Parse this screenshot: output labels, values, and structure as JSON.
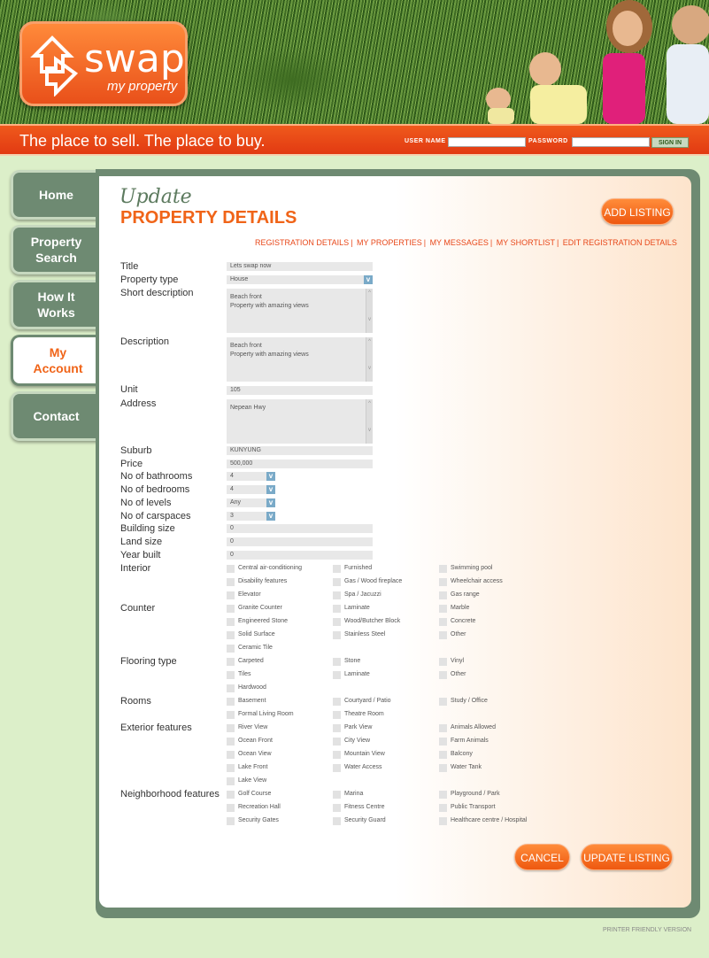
{
  "brand": {
    "name": "swap",
    "sub": "my property"
  },
  "tagline": "The place to sell. The place to buy.",
  "login": {
    "user_label": "USER NAME",
    "pass_label": "PASSWORD",
    "signin": "SIGN IN"
  },
  "nav": [
    {
      "label": "Home"
    },
    {
      "label": "Property Search"
    },
    {
      "label": "How It Works"
    },
    {
      "label": "My Account"
    },
    {
      "label": "Contact"
    }
  ],
  "heading": {
    "script": "Update",
    "main": "PROPERTY DETAILS"
  },
  "add_listing": "ADD LISTING",
  "links": [
    "REGISTRATION DETAILS",
    "MY PROPERTIES",
    "MY MESSAGES",
    "MY SHORTLIST",
    "EDIT REGISTRATION DETAILS"
  ],
  "fields": {
    "title": {
      "label": "Title",
      "value": "Lets swap now"
    },
    "ptype": {
      "label": "Property type",
      "value": "House"
    },
    "short": {
      "label": "Short description",
      "line1": "Beach front",
      "line2": "Property with amazing views"
    },
    "desc": {
      "label": "Description",
      "line1": "Beach front",
      "line2": "Property with amazing views"
    },
    "unit": {
      "label": "Unit",
      "value": "105"
    },
    "address": {
      "label": "Address",
      "value": "Nepean Hwy"
    },
    "suburb": {
      "label": "Suburb",
      "value": "KUNYUNG"
    },
    "price": {
      "label": "Price",
      "value": "500,000"
    },
    "baths": {
      "label": "No of bathrooms",
      "value": "4"
    },
    "beds": {
      "label": "No of bedrooms",
      "value": "4"
    },
    "levels": {
      "label": "No of levels",
      "value": "Any"
    },
    "cars": {
      "label": "No of carspaces",
      "value": "3"
    },
    "bsize": {
      "label": "Building size",
      "value": "0"
    },
    "lsize": {
      "label": "Land size",
      "value": "0"
    },
    "year": {
      "label": "Year built",
      "value": "0"
    }
  },
  "groups": [
    {
      "label": "Interior",
      "items": [
        "Central air-conditioning",
        "Furnished",
        "Swimming pool",
        "Disability features",
        "Gas / Wood fireplace",
        "Wheelchair access",
        "Elevator",
        "Spa / Jacuzzi",
        "Gas range"
      ]
    },
    {
      "label": "Counter",
      "items": [
        "Granite Counter",
        "Laminate",
        "Marble",
        "Engineered Stone",
        "Wood/Butcher Block",
        "Concrete",
        "Solid Surface",
        "Stainless Steel",
        "Other",
        "Ceramic Tile"
      ]
    },
    {
      "label": "Flooring type",
      "items": [
        "Carpeted",
        "Stone",
        "Vinyl",
        "Tiles",
        "Laminate",
        "Other",
        "Hardwood"
      ]
    },
    {
      "label": "Rooms",
      "items": [
        "Basement",
        "Courtyard / Patio",
        "Study / Office",
        "Formal Living Room",
        "Theatre Room"
      ]
    },
    {
      "label": "Exterior features",
      "items": [
        "River View",
        "Park View",
        "Animals Allowed",
        "Ocean Front",
        "City View",
        "Farm Animals",
        "Ocean View",
        "Mountain View",
        "Balcony",
        "Lake Front",
        "Water Access",
        "Water Tank",
        "Lake View"
      ]
    },
    {
      "label": "Neighborhood features",
      "items": [
        "Golf Course",
        "Marina",
        "Playground / Park",
        "Recreation Hall",
        "Fitness Centre",
        "Public Transport",
        "Security Gates",
        "Security Guard",
        "Healthcare centre / Hospital"
      ]
    }
  ],
  "actions": {
    "cancel": "CANCEL",
    "update": "UPDATE LISTING"
  },
  "printer": "PRINTER FRIENDLY VERSION",
  "colors": {
    "accent": "#f06418",
    "nav": "#6e8a72",
    "bg": "#dcefc9"
  }
}
